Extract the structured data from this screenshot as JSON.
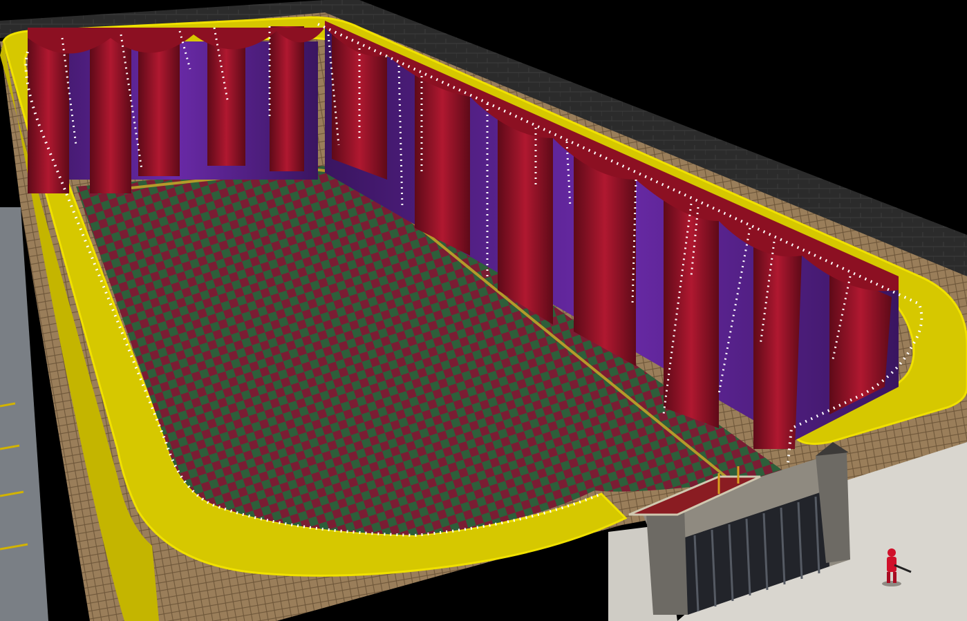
{
  "scene": {
    "description_visible_text": [],
    "colors": {
      "sky": "#000000",
      "wall_dark": "#2a2a2a",
      "wall_light": "#d9d6cf",
      "tile_frame": "#8a6f4e",
      "road": "#7a7f85",
      "road_line": "#d2b300",
      "rail_yellow": "#e1d200",
      "floor_red": "#7a1d33",
      "floor_green": "#2e5e3a",
      "floor_line": "#b49a2a",
      "curtain_red": "#a0122a",
      "curtain_purple": "#5a2590",
      "lights": "#ffffff",
      "gate_dark": "#22242a",
      "unit_red": "#d0102a"
    },
    "objects": [
      {
        "name": "arena-floor",
        "kind": "checkered floor"
      },
      {
        "name": "curtain-wall",
        "kind": "red and purple theatre curtains"
      },
      {
        "name": "yellow-rail",
        "kind": "surrounding yellow ledge with light strings"
      },
      {
        "name": "entrance-gate",
        "kind": "iron gate with stone towers"
      },
      {
        "name": "red-soldier-unit",
        "kind": "player unit"
      }
    ]
  }
}
